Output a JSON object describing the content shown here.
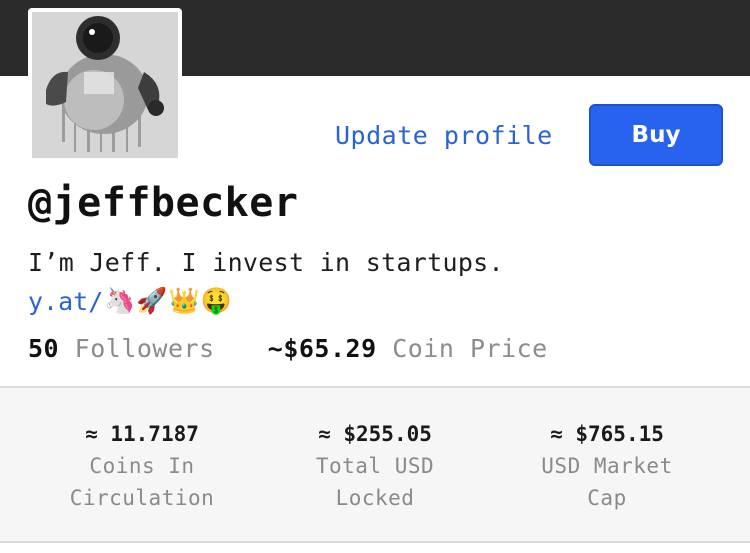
{
  "profile": {
    "handle": "@jeffbecker",
    "bio": "I’m Jeff. I invest in startups.",
    "link_text": "y.at/",
    "link_emojis": [
      "🦄",
      "🚀",
      "👑",
      "🤑"
    ],
    "avatar_icon": "astronaut-avatar"
  },
  "actions": {
    "update_profile": "Update profile",
    "buy": "Buy"
  },
  "stats": {
    "followers_count": "50",
    "followers_label": "Followers",
    "coin_price": "~$65.29",
    "coin_price_label": "Coin Price"
  },
  "metrics": [
    {
      "value": "≈ 11.7187",
      "label_line1": "Coins In",
      "label_line2": "Circulation"
    },
    {
      "value": "≈ $255.05",
      "label_line1": "Total USD",
      "label_line2": "Locked"
    },
    {
      "value": "≈ $765.15",
      "label_line1": "USD Market",
      "label_line2": "Cap"
    }
  ],
  "colors": {
    "topbar": "#2b2b2b",
    "accent": "#2763ee",
    "link": "#2a63d4",
    "muted": "#8c8c8c"
  }
}
